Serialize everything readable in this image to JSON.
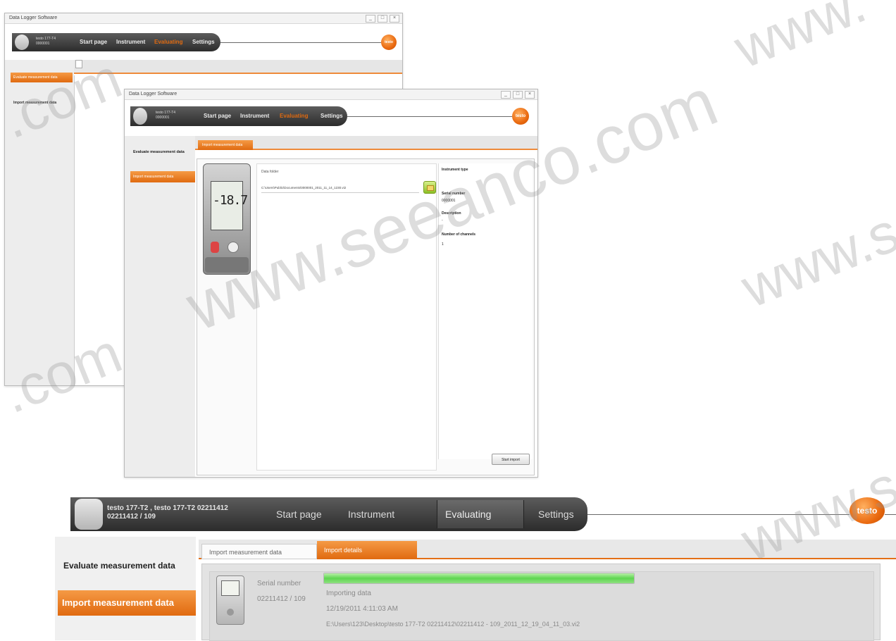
{
  "back_window": {
    "title": "Data Logger Software",
    "instrument_line1": "testo 177-T4",
    "instrument_line2": "0000001",
    "nav": [
      "Start page",
      "Instrument",
      "Evaluating",
      "Settings"
    ],
    "sidebar": [
      "Evaluate measurement data",
      "Import measurement data"
    ],
    "logo": "testo",
    "window_controls": [
      "_",
      "□",
      "×"
    ]
  },
  "middle_window": {
    "title": "Data Logger Software",
    "instrument_line1": "testo 177-T4",
    "instrument_line2": "0000001",
    "nav": [
      "Start page",
      "Instrument",
      "Evaluating",
      "Settings"
    ],
    "sidebar": [
      "Evaluate measurement data",
      "Import measurement data"
    ],
    "tab": "Import measurement data",
    "display_value": "-18.7",
    "file_label": "Data folder",
    "file_path": "C:\\Users\\Public\\Documents\\0000001_2011_11_14_1230.vi2",
    "info": {
      "heading": "Instrument type",
      "serial_label": "Serial number",
      "serial_value": "0000001",
      "description_label": "Description",
      "description_value": "-",
      "channels_label": "Number of channels",
      "channels_value": "1"
    },
    "start_button": "Start import",
    "logo": "testo",
    "window_controls": [
      "_",
      "□",
      "×"
    ]
  },
  "front_window": {
    "instrument_line1": "testo 177-T2 , testo 177-T2 02211412",
    "instrument_line2": "02211412 / 109",
    "nav": [
      "Start page",
      "Instrument",
      "Evaluating",
      "Settings"
    ],
    "sidebar_heading": "Evaluate measurement data",
    "sidebar_active": "Import measurement data",
    "tabs": [
      "Import measurement data",
      "Import details"
    ],
    "serial_label": "Serial number",
    "serial_value": "02211412 / 109",
    "progress": 1.0,
    "status": "Importing data",
    "timestamp": "12/19/2011 4:11:03 AM",
    "path": "E:\\Users\\123\\Desktop\\testo 177-T2 02211412\\02211412 - 109_2011_12_19_04_11_03.vi2",
    "logo": "testo"
  },
  "watermarks": [
    "www.seeanco.com",
    ".com",
    "www.s",
    "www.",
    "www.s",
    ".com"
  ],
  "colors": {
    "accent": "#e06a10",
    "progress": "#69d85f",
    "nav_bg": "#3a3a3a"
  }
}
